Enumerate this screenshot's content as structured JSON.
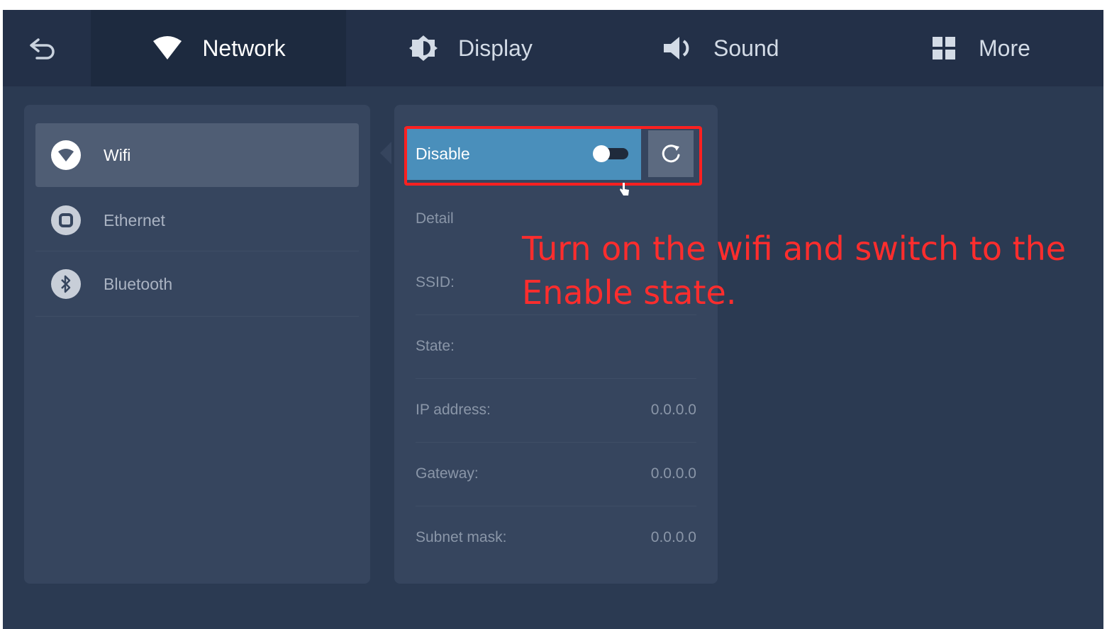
{
  "header": {
    "back_icon": "back-arrow-icon",
    "tabs": [
      {
        "label": "Network",
        "icon": "wifi-icon",
        "active": true
      },
      {
        "label": "Display",
        "icon": "brightness-icon",
        "active": false
      },
      {
        "label": "Sound",
        "icon": "speaker-icon",
        "active": false
      },
      {
        "label": "More",
        "icon": "grid-icon",
        "active": false
      }
    ]
  },
  "sidebar": {
    "items": [
      {
        "label": "Wifi",
        "icon": "wifi-icon",
        "active": true
      },
      {
        "label": "Ethernet",
        "icon": "ethernet-icon",
        "active": false
      },
      {
        "label": "Bluetooth",
        "icon": "bluetooth-icon",
        "active": false
      }
    ]
  },
  "wifi": {
    "toggle_label": "Disable",
    "toggle_on": false,
    "refresh_icon": "refresh-icon",
    "detail_heading": "Detail",
    "rows": [
      {
        "label": "SSID:",
        "value": ""
      },
      {
        "label": "State:",
        "value": ""
      },
      {
        "label": "IP address:",
        "value": "0.0.0.0"
      },
      {
        "label": "Gateway:",
        "value": "0.0.0.0"
      },
      {
        "label": "Subnet mask:",
        "value": "0.0.0.0"
      }
    ]
  },
  "annotation": {
    "text": "Turn on the wifi and switch to the Enable state."
  },
  "colors": {
    "background": "#2b3a52",
    "topbar": "#233048",
    "panel": "#36455e",
    "toggle_bar": "#4a8fbb",
    "highlight": "#ff2020",
    "annotation": "#ff2d2d"
  }
}
